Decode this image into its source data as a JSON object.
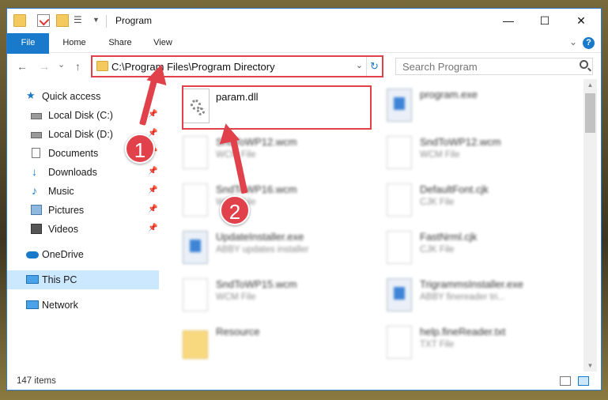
{
  "window": {
    "title": "Program",
    "controls": {
      "minimize": "—",
      "maximize": "☐",
      "close": "✕"
    }
  },
  "ribbon": {
    "tabs": [
      "File",
      "Home",
      "Share",
      "View"
    ],
    "help": "?"
  },
  "nav": {
    "back": "←",
    "forward": "→",
    "recent": "⌄",
    "up": "↑",
    "address": "C:\\Program Files\\Program Directory",
    "search_placeholder": "Search Program"
  },
  "sidebar": {
    "items": [
      {
        "label": "Quick access",
        "icon": "star-icon"
      },
      {
        "label": "Local Disk (C:)",
        "icon": "drive-icon"
      },
      {
        "label": "Local Disk (D:)",
        "icon": "drive-icon"
      },
      {
        "label": "Documents",
        "icon": "documents-icon"
      },
      {
        "label": "Downloads",
        "icon": "download-icon"
      },
      {
        "label": "Music",
        "icon": "music-icon"
      },
      {
        "label": "Pictures",
        "icon": "pictures-icon"
      },
      {
        "label": "Videos",
        "icon": "videos-icon"
      },
      {
        "label": "OneDrive",
        "icon": "cloud-icon"
      },
      {
        "label": "This PC",
        "icon": "pc-icon"
      },
      {
        "label": "Network",
        "icon": "network-icon"
      }
    ]
  },
  "files": [
    {
      "name": "param.dll",
      "type": ""
    },
    {
      "name": "program.exe",
      "type": ""
    },
    {
      "name": "SndToWP12.wcm",
      "type": "WCM File"
    },
    {
      "name": "SndToWP12.wcm",
      "type": "WCM File"
    },
    {
      "name": "SndToWP16.wcm",
      "type": "WCM File"
    },
    {
      "name": "DefaultFont.cjk",
      "type": "CJK File"
    },
    {
      "name": "UpdateInstaller.exe",
      "type": "ABBY updates installer"
    },
    {
      "name": "FastNrml.cjk",
      "type": "CJK File"
    },
    {
      "name": "SndToWP15.wcm",
      "type": "WCM File"
    },
    {
      "name": "TrigrammsInstaller.exe",
      "type": "ABBY finereader tri..."
    },
    {
      "name": "Resource",
      "type": ""
    },
    {
      "name": "help.fineReader.txt",
      "type": "TXT File"
    }
  ],
  "status": {
    "count": "147 items"
  },
  "annotations": {
    "step1": "1",
    "step2": "2"
  },
  "colors": {
    "accent": "#1979ca",
    "highlight": "#e0414a",
    "selected": "#cce8ff"
  }
}
